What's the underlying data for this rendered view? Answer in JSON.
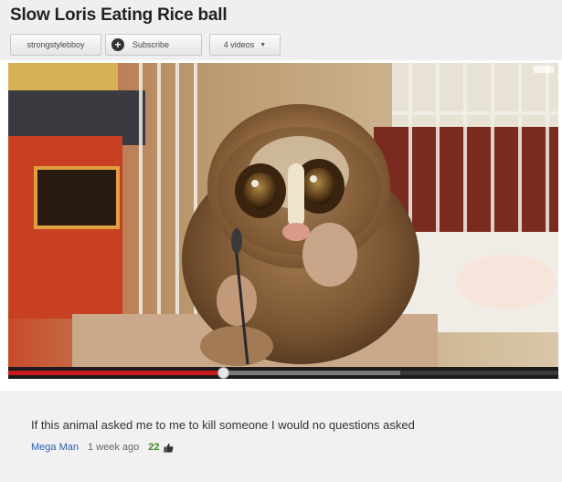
{
  "video": {
    "title": "Slow Loris Eating Rice ball",
    "channel_button": "strongstylebboy",
    "subscribe_button": "Subscribe",
    "videos_button": "4 videos",
    "progress_fraction": 0.39
  },
  "comment": {
    "text": "If this animal asked me to me to kill someone I would no questions asked",
    "author": "Mega Man",
    "time": "1 week ago",
    "likes": "22"
  },
  "icons": {
    "subscribe": "plus-icon",
    "dropdown": "caret-down-icon",
    "like": "thumbs-up-icon"
  },
  "colors": {
    "progress_played": "#c8191f",
    "author_link": "#2b5fb0",
    "likes": "#3a8a24"
  }
}
